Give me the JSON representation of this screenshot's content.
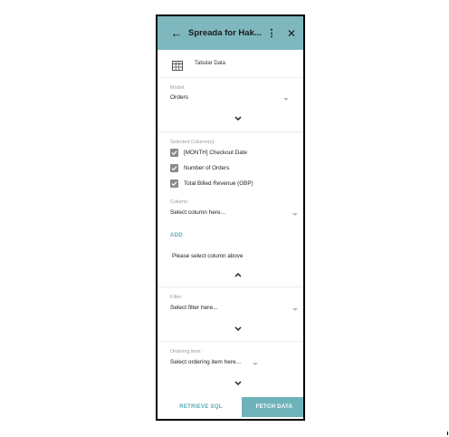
{
  "header": {
    "title": "Spreada for Hak...",
    "back_icon": "arrow-left-icon",
    "more_icon": "more-vertical-icon",
    "close_icon": "close-icon",
    "color": "#7eb8be"
  },
  "source": {
    "label": "Tabular Data",
    "icon": "table-icon"
  },
  "model": {
    "label": "Model:",
    "value": "Orders"
  },
  "selected_columns": {
    "label": "Selected Column(s):",
    "items": [
      {
        "label": "[MONTH] Checkout Date",
        "checked": true
      },
      {
        "label": "Number of Orders",
        "checked": true
      },
      {
        "label": "Total Billed Revenue (GBP)",
        "checked": true
      }
    ]
  },
  "column": {
    "label": "Column:",
    "placeholder": "Select column here...",
    "add_label": "ADD",
    "hint": "Please select column above"
  },
  "filter": {
    "label": "Filter:",
    "placeholder": "Select filter here..."
  },
  "ordering": {
    "label": "Ordering item:",
    "placeholder": "Select ordering item here..."
  },
  "footer": {
    "retrieve_label": "RETRIEVE SQL",
    "fetch_label": "FETCH DATA",
    "accent": "#6fb3ba"
  }
}
